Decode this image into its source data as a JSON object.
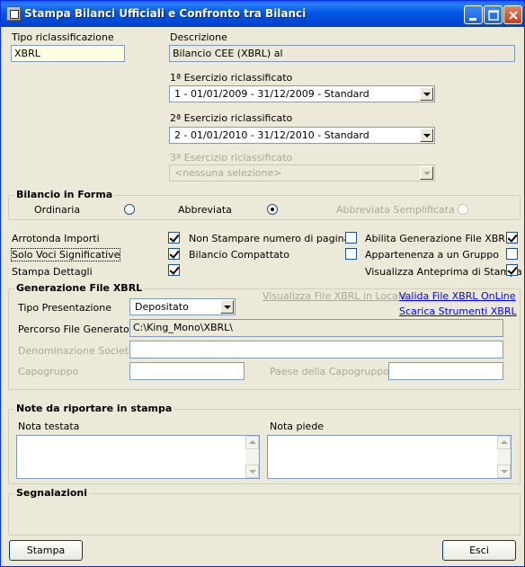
{
  "window": {
    "title": "Stampa Bilanci Ufficiali e Confronto tra Bilanci"
  },
  "top": {
    "tipo_label": "Tipo riclassificazione",
    "tipo_value": "XBRL",
    "descr_label": "Descrizione",
    "descr_value": "Bilancio CEE (XBRL) al",
    "es1_label": "1ª Esercizio riclassificato",
    "es1_value": "1 - 01/01/2009 - 31/12/2009 - Standard",
    "es2_label": "2ª Esercizio riclassificato",
    "es2_value": "2 - 01/01/2010 - 31/12/2010 - Standard",
    "es3_label": "3ª Esercizio riclassificato",
    "es3_value": "<nessuna selezione>"
  },
  "forma": {
    "title": "Bilancio in Forma",
    "ordinaria": "Ordinaria",
    "abbreviata": "Abbreviata",
    "semplificata": "Abbreviata Semplificata",
    "selected": "Abbreviata"
  },
  "options": {
    "arrotonda": {
      "label": "Arrotonda Importi",
      "checked": true
    },
    "solo_voci": {
      "label": "Solo Voci Significative",
      "checked": true
    },
    "stampa_dettagli": {
      "label": "Stampa Dettagli",
      "checked": true
    },
    "non_stampare": {
      "label": "Non Stampare numero di pagina",
      "checked": false
    },
    "compattato": {
      "label": "Bilancio Compattato",
      "checked": false
    },
    "abilita_xbrl": {
      "label": "Abilita Generazione File XBRL",
      "checked": true
    },
    "gruppo": {
      "label": "Appartenenza a un Gruppo",
      "checked": false
    },
    "anteprima": {
      "label": "Visualizza Anteprima di Stampa",
      "checked": true
    }
  },
  "xbrl": {
    "title": "Generazione File XBRL",
    "tipo_label": "Tipo Presentazione",
    "tipo_value": "Depositato",
    "link_locale": "Visualizza File XBRL in Locale",
    "link_valida": "Valida File XBRL OnLine",
    "link_scarica": "Scarica Strumenti XBRL",
    "percorso_label": "Percorso File Generato",
    "percorso_value": "C:\\King_Mono\\XBRL\\",
    "denominazione_label": "Denominazione Società",
    "capogruppo_label": "Capogruppo",
    "paese_label": "Paese della Capogruppo"
  },
  "note": {
    "title": "Note da riportare in stampa",
    "testata_label": "Nota testata",
    "piede_label": "Nota piede"
  },
  "segnalazioni": {
    "title": "Segnalazioni"
  },
  "buttons": {
    "stampa": "Stampa",
    "esci": "Esci"
  }
}
